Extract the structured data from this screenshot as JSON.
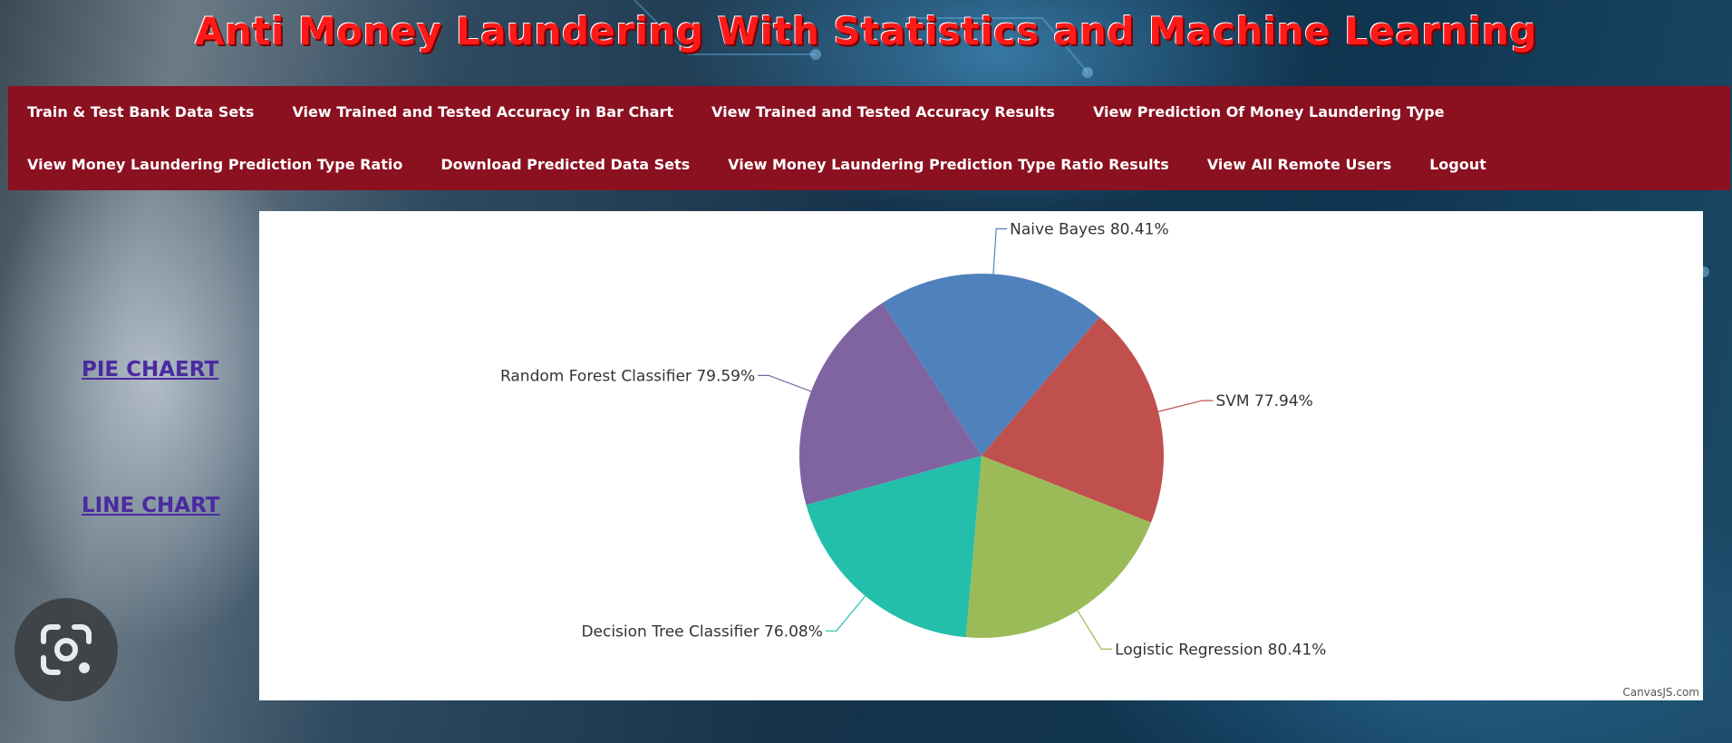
{
  "header": {
    "title": "Anti Money Laundering With Statistics and Machine Learning"
  },
  "nav": {
    "row1": [
      "Train & Test Bank Data Sets",
      "View Trained and Tested Accuracy in Bar Chart",
      "View Trained and Tested Accuracy Results",
      "View Prediction Of Money Laundering Type"
    ],
    "row2": [
      "View Money Laundering Prediction Type Ratio",
      "Download Predicted Data Sets",
      "View Money Laundering Prediction Type Ratio Results",
      "View All Remote Users",
      "Logout"
    ]
  },
  "sidebar": {
    "pie_link": "PIE CHAERT",
    "line_link": "LINE CHART"
  },
  "chart_credit": "CanvasJS.com",
  "icons": {
    "lens": "google-lens-icon"
  },
  "chart_data": {
    "type": "pie",
    "slices": [
      {
        "label": "Naive Bayes",
        "value": 80.41,
        "display": "Naive Bayes 80.41%",
        "color": "#4f81bc"
      },
      {
        "label": "SVM",
        "value": 77.94,
        "display": "SVM 77.94%",
        "color": "#c0504e"
      },
      {
        "label": "Logistic Regression",
        "value": 80.41,
        "display": "Logistic Regression 80.41%",
        "color": "#9bbb58"
      },
      {
        "label": "Decision Tree Classifier",
        "value": 76.08,
        "display": "Decision Tree Classifier 76.08%",
        "color": "#23bfaa"
      },
      {
        "label": "Random Forest Classifier",
        "value": 79.59,
        "display": "Random Forest Classifier 79.59%",
        "color": "#8064a1"
      }
    ]
  }
}
